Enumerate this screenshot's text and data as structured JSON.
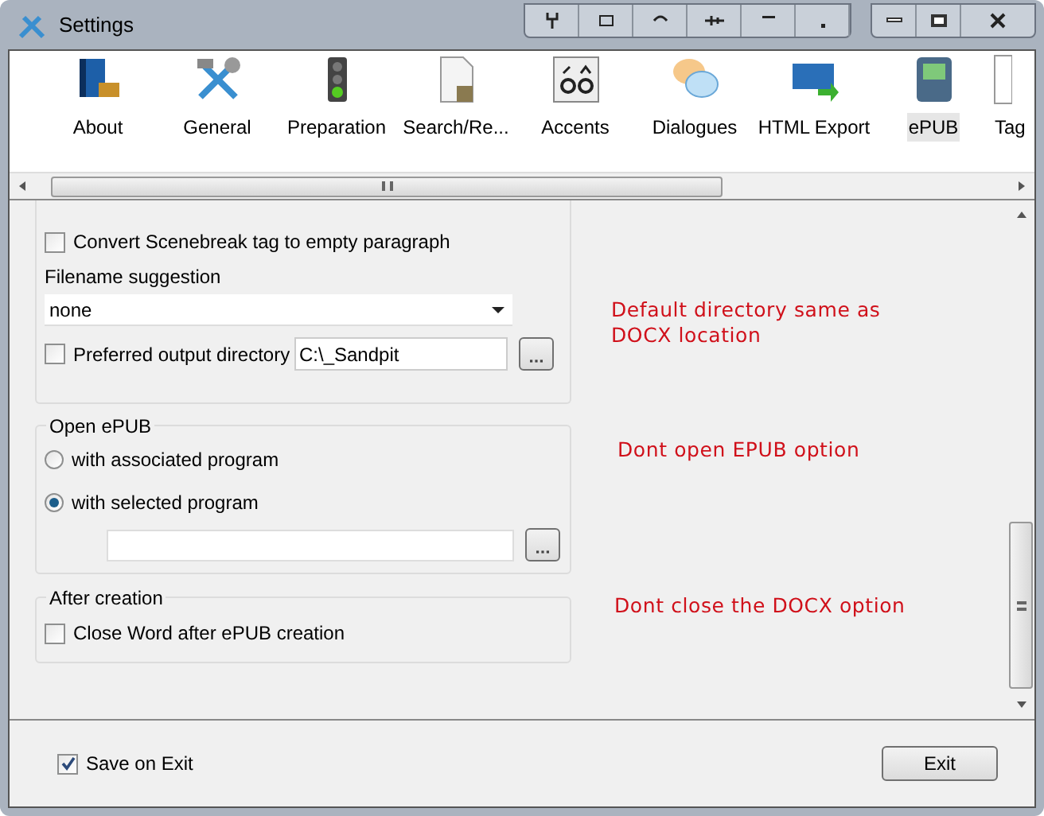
{
  "window": {
    "title": "Settings"
  },
  "toolbar": {
    "items": [
      {
        "label": "About",
        "selected": false
      },
      {
        "label": "General",
        "selected": false
      },
      {
        "label": "Preparation",
        "selected": false
      },
      {
        "label": "Search/Re...",
        "selected": false
      },
      {
        "label": "Accents",
        "selected": false
      },
      {
        "label": "Dialogues",
        "selected": false
      },
      {
        "label": "HTML Export",
        "selected": false
      },
      {
        "label": "ePUB",
        "selected": true
      },
      {
        "label": "Tag",
        "selected": false
      }
    ]
  },
  "export": {
    "convert_scenebreak": {
      "label": "Convert Scenebreak tag to empty paragraph",
      "checked": false
    },
    "filename_label": "Filename suggestion",
    "filename_value": "none",
    "preferred_dir": {
      "label": "Preferred output directory",
      "checked": false,
      "value": "C:\\_Sandpit"
    }
  },
  "open_epub": {
    "title": "Open ePUB",
    "options": [
      {
        "label": "with associated program",
        "selected": false
      },
      {
        "label": "with selected program",
        "selected": true
      }
    ]
  },
  "after_creation": {
    "title": "After creation",
    "close_word": {
      "label": "Close Word after ePUB creation",
      "checked": false
    }
  },
  "annotations": [
    "Default directory same as DOCX location",
    "Dont open EPUB option",
    "Dont close the DOCX option"
  ],
  "footer": {
    "save_on_exit": {
      "label": "Save on Exit",
      "checked": true
    },
    "exit_button": "Exit"
  }
}
